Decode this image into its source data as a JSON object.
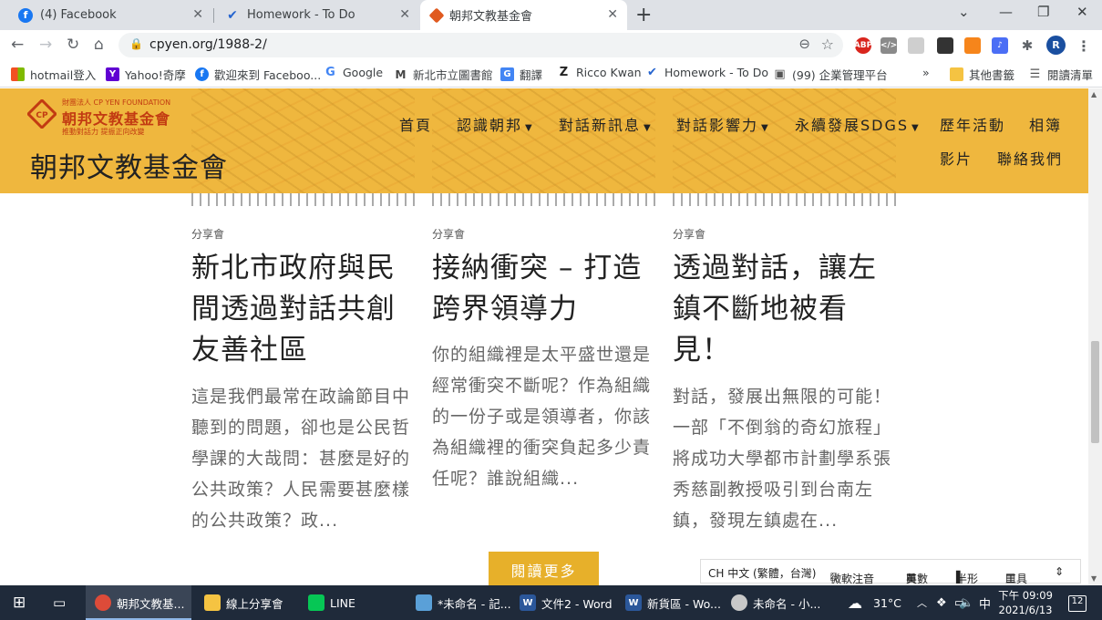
{
  "browser": {
    "tabs": [
      {
        "title": "(4) Facebook",
        "icon": "facebook-icon",
        "color": "#1877f2"
      },
      {
        "title": "Homework - To Do",
        "icon": "todo-icon",
        "color": "#2564cf"
      },
      {
        "title": "朝邦文教基金會",
        "icon": "cpyen-icon",
        "color": "#e05a1f",
        "active": true
      }
    ],
    "url": "cpyen.org/1988-2/",
    "profile_initial": "R",
    "extensions": [
      {
        "name": "abp-icon",
        "label": "ABP",
        "color": "#d9251d"
      }
    ]
  },
  "bookmarks": [
    {
      "label": "hotmail登入",
      "icon": "windows-icon",
      "color": "#f25022"
    },
    {
      "label": "Yahoo!奇摩",
      "icon": "yahoo-icon",
      "color": "#6001d2",
      "glyph": "Y"
    },
    {
      "label": "歡迎來到 Faceboo...",
      "icon": "facebook-icon",
      "color": "#1877f2",
      "glyph": "f"
    },
    {
      "label": "Google",
      "icon": "google-icon",
      "color": "#4285f4",
      "glyph": "G"
    },
    {
      "label": "新北市立圖書館",
      "icon": "library-icon",
      "color": "#444444",
      "glyph": "M"
    },
    {
      "label": "翻譯",
      "icon": "translate-icon",
      "color": "#4285f4",
      "glyph": "G"
    },
    {
      "label": "Ricco Kwan",
      "icon": "ricco-icon",
      "color": "#222222",
      "glyph": "Z"
    },
    {
      "label": "Homework - To Do",
      "icon": "todo-icon",
      "color": "#2564cf",
      "glyph": "✔"
    },
    {
      "label": "(99) 企業管理平台",
      "icon": "platform-icon",
      "color": "#555555",
      "glyph": "▣"
    },
    {
      "label": "其他書籤",
      "icon": "folder-icon",
      "color": "#f5c342",
      "glyph": ""
    },
    {
      "label": "閱讀清單",
      "icon": "reading-list-icon",
      "color": "#555555",
      "glyph": "☰"
    }
  ],
  "bookmarks_more": "»",
  "site": {
    "logo_small": "財團法人 CP YEN FOUNDATION",
    "logo_main": "朝邦文教基金會",
    "logo_slogan": "推動對話力 提振正向改變",
    "title": "朝邦文教基金會",
    "menu": [
      {
        "label": "首頁",
        "caret": false
      },
      {
        "label": "認識朝邦",
        "caret": true
      },
      {
        "label": "對話新訊息",
        "caret": true
      },
      {
        "label": "對話影響力",
        "caret": true
      },
      {
        "label": "永續發展SDGS",
        "caret": true
      },
      {
        "label": "歷年活動",
        "caret": false
      },
      {
        "label": "相簿",
        "caret": false
      },
      {
        "label": "影片",
        "caret": false
      },
      {
        "label": "聯絡我們",
        "caret": false
      }
    ]
  },
  "posts": [
    {
      "category": "分享會",
      "title": "新北市政府與民間透過對話共創友善社區",
      "excerpt": "這是我們最常在政論節目中聽到的問題，卻也是公民哲學課的大哉問：甚麼是好的公共政策？人民需要甚麼樣的公共政策？政..."
    },
    {
      "category": "分享會",
      "title": "接納衝突 – 打造跨界領導力",
      "excerpt": "你的組織裡是太平盛世還是經常衝突不斷呢？作為組織的一份子或是領導者，你該為組織裡的衝突負起多少責任呢？誰說組織..."
    },
    {
      "category": "分享會",
      "title": "透過對話，讓左鎮不斷地被看見！",
      "excerpt": "對話，發展出無限的可能！一部「不倒翁的奇幻旅程」將成功大學都市計劃學系張秀慈副教授吸引到台南左鎮，發現左鎮處在..."
    }
  ],
  "read_more": "閱讀更多",
  "ime": {
    "lang": "CH 中文 (繁體，台灣)",
    "phonetic": "微軟注音",
    "english": "英數",
    "halfwidth": "半形",
    "tools": "工具"
  },
  "taskbar": {
    "items": [
      {
        "label": "朝邦文教基...",
        "icon": "chrome-icon",
        "color": "#dd4b39",
        "active": true
      },
      {
        "label": "線上分享會",
        "icon": "folder-icon",
        "color": "#f5c342"
      },
      {
        "label": "LINE",
        "icon": "line-icon",
        "color": "#06c755"
      },
      {
        "label": "*未命名 - 記...",
        "icon": "notepad-icon",
        "color": "#5aa0d8"
      },
      {
        "label": "文件2 - Word",
        "icon": "word-icon",
        "color": "#2b579a"
      },
      {
        "label": "新貨區 - Wo...",
        "icon": "word-icon",
        "color": "#2b579a"
      },
      {
        "label": "未命名 - 小...",
        "icon": "paint-icon",
        "color": "#c8c8c8"
      }
    ],
    "weather": "31°C",
    "ime_indicator": "中",
    "time": "下午 09:09",
    "date": "2021/6/13",
    "notifications": "12"
  }
}
